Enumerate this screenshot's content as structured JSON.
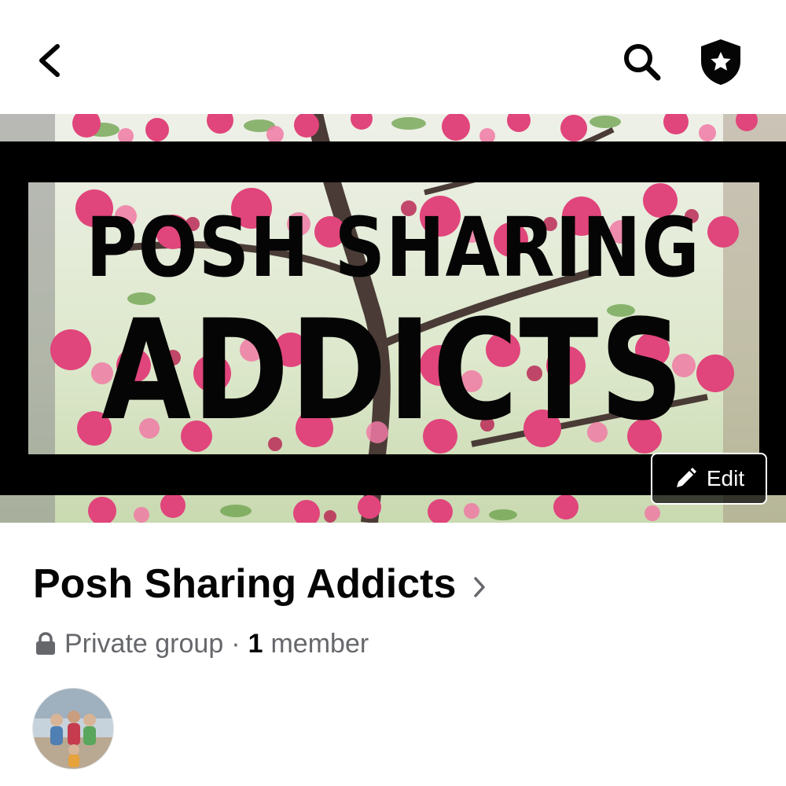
{
  "nav": {
    "back_icon": "chevron-left-icon",
    "search_icon": "search-icon",
    "admin_icon": "shield-star-icon"
  },
  "cover": {
    "line1": "POSH SHARING",
    "line2": "ADDICTS",
    "edit_label": "Edit",
    "edit_icon": "pencil-icon"
  },
  "group": {
    "name": "Posh Sharing Addicts",
    "privacy": "Private group",
    "separator": "·",
    "member_count": "1",
    "member_label": "member",
    "privacy_icon": "lock-icon"
  },
  "colors": {
    "text_primary": "#050505",
    "text_secondary": "#65676b",
    "blossom": "#e0457b",
    "band": "#000000"
  }
}
